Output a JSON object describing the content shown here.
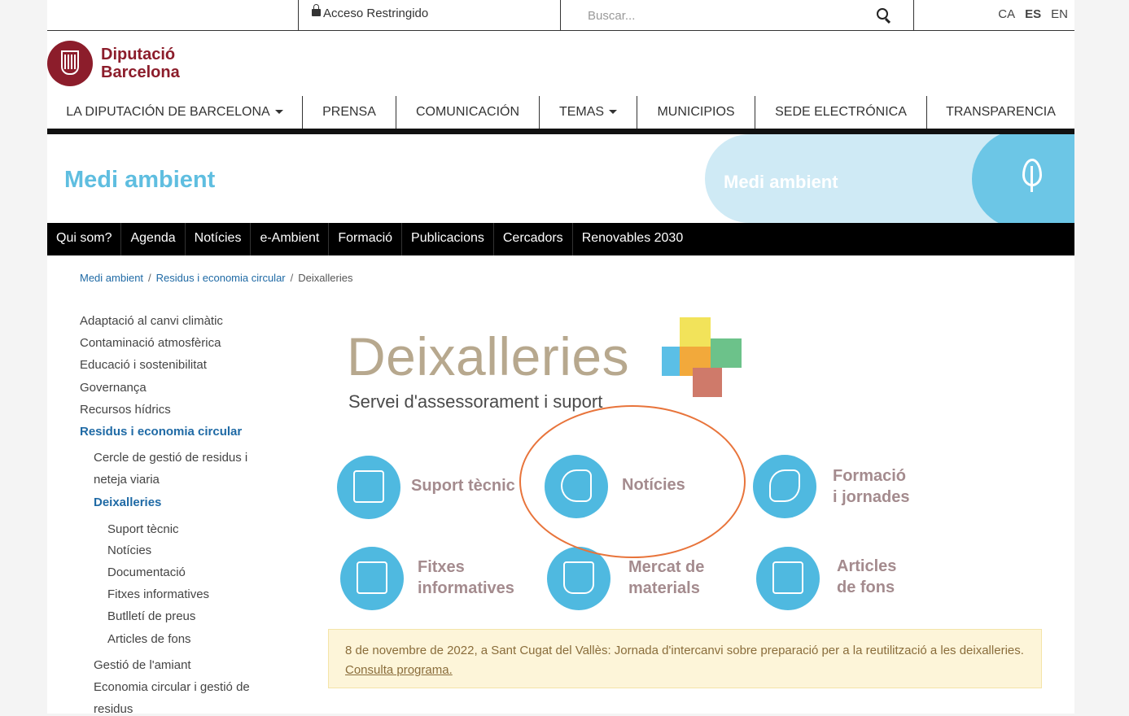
{
  "topbar": {
    "restricted_label": "Acceso Restringido",
    "search_placeholder": "Buscar...",
    "languages": [
      "CA",
      "ES",
      "EN"
    ],
    "current_language": "ES"
  },
  "logo": {
    "line1": "Diputació",
    "line2": "Barcelona"
  },
  "main_nav": [
    {
      "label": "LA DIPUTACIÓN DE BARCELONA",
      "dropdown": true
    },
    {
      "label": "PRENSA",
      "dropdown": false
    },
    {
      "label": "COMUNICACIÓN",
      "dropdown": false
    },
    {
      "label": "TEMAS",
      "dropdown": true
    },
    {
      "label": "MUNICIPIOS",
      "dropdown": false
    },
    {
      "label": "SEDE ELECTRÓNICA",
      "dropdown": false
    },
    {
      "label": "TRANSPARENCIA",
      "dropdown": false
    }
  ],
  "banner": {
    "title": "Medi ambient",
    "pill_label": "Medi ambient"
  },
  "sub_nav": [
    "Qui som?",
    "Agenda",
    "Notícies",
    "e-Ambient",
    "Formació",
    "Publicacions",
    "Cercadors",
    "Renovables 2030"
  ],
  "breadcrumb": [
    "Medi ambient",
    "Residus i economia circular",
    "Deixalleries"
  ],
  "sidebar": {
    "items": [
      "Adaptació al canvi climàtic",
      "Contaminació atmosfèrica",
      "Educació i sostenibilitat",
      "Governança",
      "Recursos hídrics",
      "Residus i economia circular",
      "Cercle de gestió de residus i",
      "neteja viaria",
      "Deixalleries",
      "Suport tècnic",
      "Notícies",
      "Documentació",
      "Fitxes informatives",
      "Butlletí de preus",
      "Articles de fons",
      "Gestió de l'amiant",
      "Economia circular i gestió de",
      "residus"
    ]
  },
  "hero": {
    "title": "Deixalleries",
    "subtitle": "Servei d'assessorament i suport"
  },
  "tiles": [
    {
      "line1": "Suport tècnic",
      "line2": "",
      "icon": "checklist-icon"
    },
    {
      "line1": "Notícies",
      "line2": "",
      "icon": "megaphone-icon"
    },
    {
      "line1": "Formació",
      "line2": "i jornades",
      "icon": "book-icon"
    },
    {
      "line1": "Fitxes",
      "line2": "informatives",
      "icon": "folder-icon"
    },
    {
      "line1": "Mercat de",
      "line2": "materials",
      "icon": "bucket-icon"
    },
    {
      "line1": "Articles",
      "line2": "de fons",
      "icon": "folder-icon"
    }
  ],
  "notice": {
    "text": "8 de novembre de 2022, a Sant Cugat del Vallès: Jornada d'intercanvi sobre preparació per a la reutilització a les deixalleries. ",
    "link": "Consulta programa."
  },
  "colors": {
    "accent": "#5fbee0",
    "brand": "#8c1d2b",
    "highlight_ring": "#e8743b",
    "tile_circle": "#4fb9e0"
  }
}
